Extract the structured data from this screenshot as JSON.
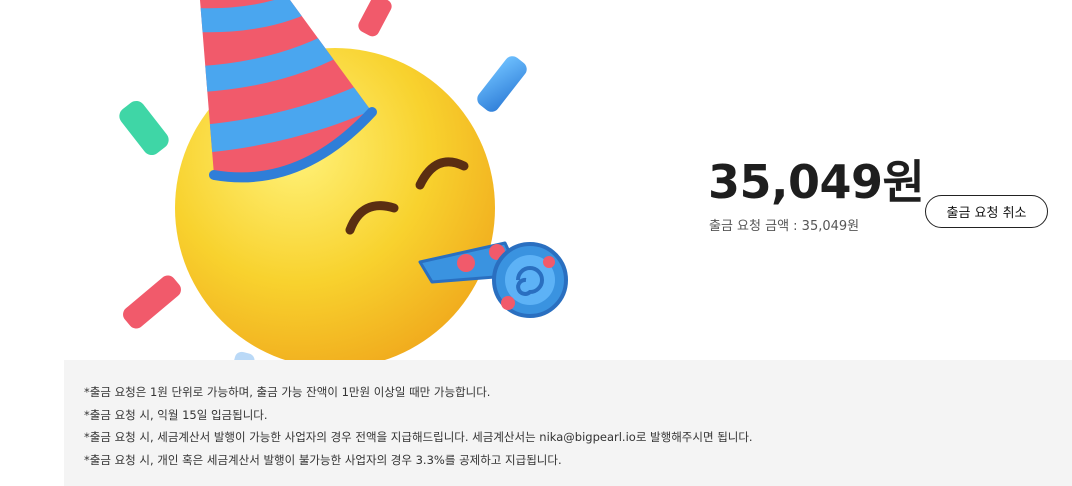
{
  "withdrawal": {
    "amount": "35,049원",
    "request_label": "출금 요청 금액 : 35,049원",
    "cancel_button_label": "출금 요청 취소"
  },
  "notice": {
    "lines": [
      "*출금 요청은 1원 단위로 가능하며, 출금 가능 잔액이 1만원 이상일 때만 가능합니다.",
      "*출금 요청 시, 익월 15일 입금됩니다.",
      "*출금 요청 시, 세금계산서 발행이 가능한 사업자의 경우 전액을 지급해드립니다. 세금계산서는 nika@bigpearl.io로 발행해주시면 됩니다.",
      "*출금 요청 시, 개인 혹은 세금계산서 발행이 불가능한 사업자의 경우 3.3%를 공제하고 지급됩니다."
    ]
  },
  "illustration": {
    "icon": "party-emoji-with-hat-and-blower",
    "colors": {
      "face": "#f6c92b",
      "hat_red": "#f15a6b",
      "hat_blue": "#3a93e0",
      "confetti_green": "#3fd6a6",
      "eyes": "#5a2e12"
    }
  }
}
